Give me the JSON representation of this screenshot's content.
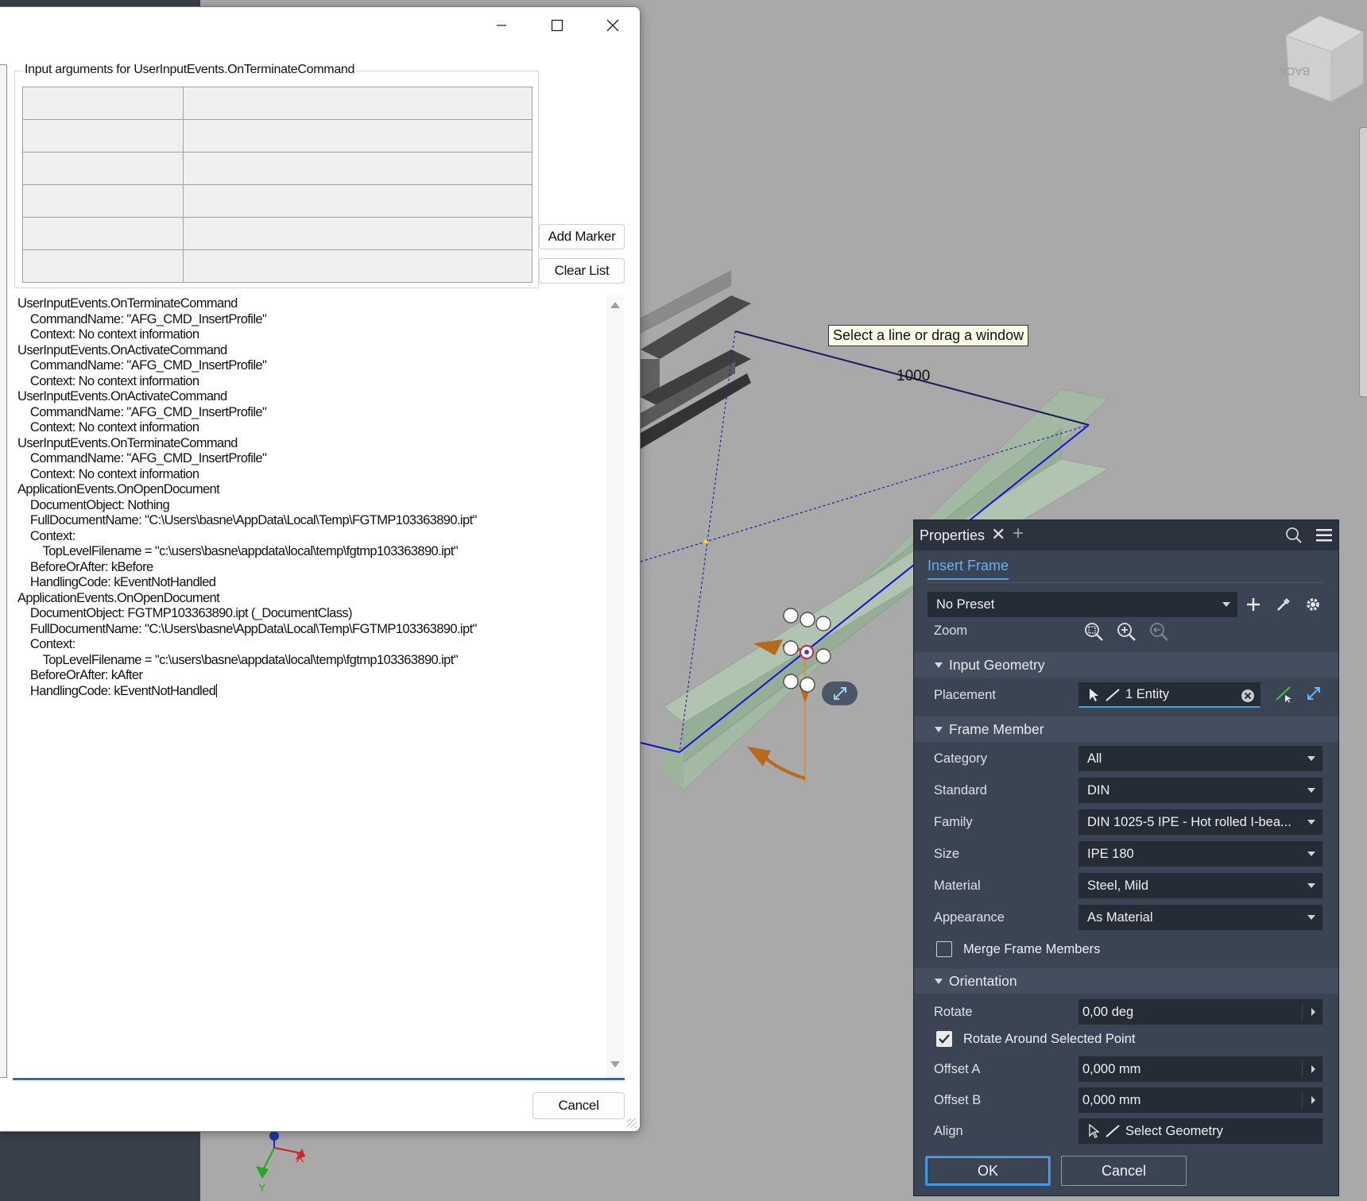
{
  "viewport": {
    "tooltip": "Select a line or drag a window",
    "dimension": "1000",
    "axis_x_label": "X",
    "axis_y_label": "Y"
  },
  "dialog": {
    "group_title": "Input arguments for UserInputEvents.OnTerminateCommand",
    "grid_rows": 6,
    "add_marker_label": "Add Marker",
    "clear_list_label": "Clear List",
    "cancel_label": "Cancel",
    "log_lines": [
      "UserInputEvents.OnTerminateCommand",
      "    CommandName: \"AFG_CMD_InsertProfile\"",
      "    Context: No context information",
      "UserInputEvents.OnActivateCommand",
      "    CommandName: \"AFG_CMD_InsertProfile\"",
      "    Context: No context information",
      "UserInputEvents.OnActivateCommand",
      "    CommandName: \"AFG_CMD_InsertProfile\"",
      "    Context: No context information",
      "UserInputEvents.OnTerminateCommand",
      "    CommandName: \"AFG_CMD_InsertProfile\"",
      "    Context: No context information",
      "ApplicationEvents.OnOpenDocument",
      "    DocumentObject: Nothing",
      "    FullDocumentName: \"C:\\Users\\basne\\AppData\\Local\\Temp\\FGTMP103363890.ipt\"",
      "    Context:",
      "        TopLevelFilename = \"c:\\users\\basne\\appdata\\local\\temp\\fgtmp103363890.ipt\"",
      "    BeforeOrAfter: kBefore",
      "    HandlingCode: kEventNotHandled",
      "ApplicationEvents.OnOpenDocument",
      "    DocumentObject: FGTMP103363890.ipt (_DocumentClass)",
      "    FullDocumentName: \"C:\\Users\\basne\\AppData\\Local\\Temp\\FGTMP103363890.ipt\"",
      "    Context:",
      "        TopLevelFilename = \"c:\\users\\basne\\appdata\\local\\temp\\fgtmp103363890.ipt\"",
      "    BeforeOrAfter: kAfter",
      "    HandlingCode: kEventNotHandled"
    ]
  },
  "properties": {
    "title": "Properties",
    "tab": "Insert Frame",
    "preset": "No Preset",
    "zoom_label": "Zoom",
    "sections": {
      "input_geometry": "Input Geometry",
      "frame_member": "Frame Member",
      "orientation": "Orientation"
    },
    "placement": {
      "label": "Placement",
      "value": "1 Entity"
    },
    "fields": {
      "category": {
        "label": "Category",
        "value": "All"
      },
      "standard": {
        "label": "Standard",
        "value": "DIN"
      },
      "family": {
        "label": "Family",
        "value": "DIN 1025-5 IPE - Hot rolled I-bea..."
      },
      "size": {
        "label": "Size",
        "value": "IPE 180"
      },
      "material": {
        "label": "Material",
        "value": "Steel, Mild"
      },
      "appearance": {
        "label": "Appearance",
        "value": "As Material"
      }
    },
    "merge_label": "Merge Frame Members",
    "merge_checked": false,
    "rotate": {
      "label": "Rotate",
      "value": "0,00 deg"
    },
    "rotate_around_label": "Rotate Around Selected Point",
    "rotate_around_checked": true,
    "offset_a": {
      "label": "Offset A",
      "value": "0,000 mm"
    },
    "offset_b": {
      "label": "Offset B",
      "value": "0,000 mm"
    },
    "align": {
      "label": "Align",
      "value": "Select Geometry"
    },
    "ok_label": "OK",
    "cancel_label": "Cancel"
  },
  "colors": {
    "panel_bg": "#3b4453",
    "accent_blue": "#4aa3ea",
    "beam_green": "#9bb89b",
    "handle_orange": "#c06a10"
  }
}
